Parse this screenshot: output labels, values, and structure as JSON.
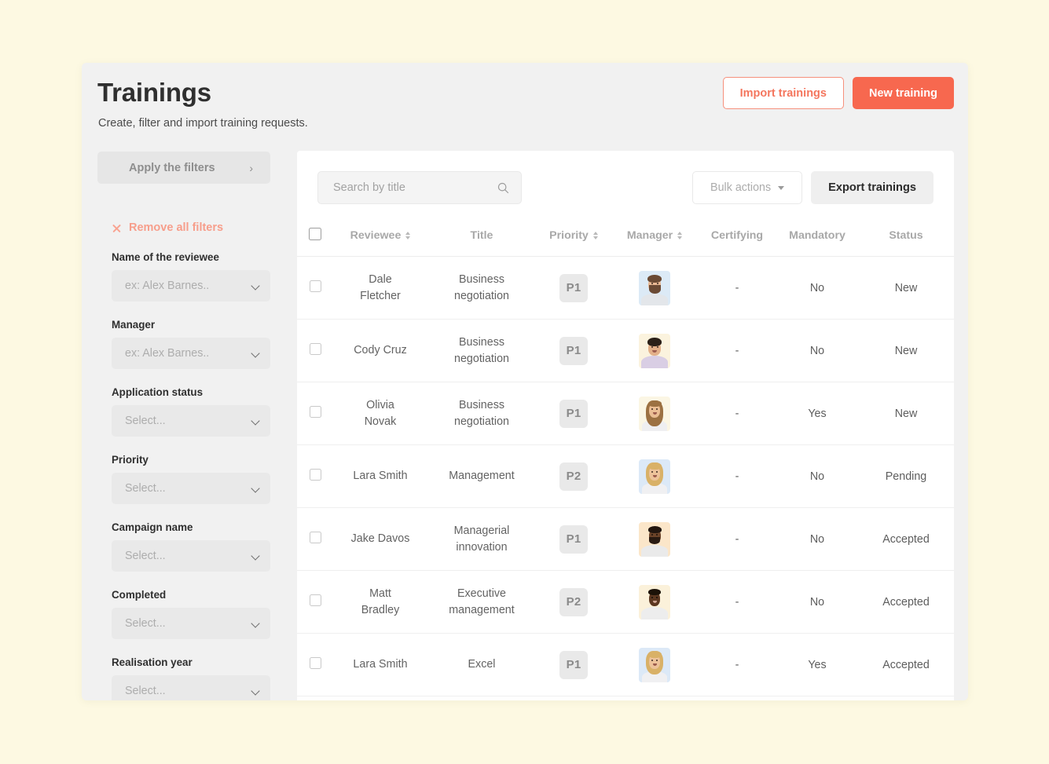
{
  "theme": {
    "page_background": "#FDF9E2",
    "card_background": "#F1F1F1",
    "panel_background": "#FFFFFF",
    "accent": "#F7684F",
    "accent_light": "#F79E8B"
  },
  "header": {
    "title": "Trainings",
    "subtitle": "Create, filter and import training requests.",
    "import_button": "Import trainings",
    "new_button": "New training"
  },
  "sidebar": {
    "apply_button": "Apply the filters",
    "apply_chevron_icon": "chevron-right-icon",
    "remove_all": "Remove all filters",
    "remove_all_icon": "close-x-icon",
    "filters": [
      {
        "label": "Name of the reviewee",
        "value": "ex: Alex Barnes.."
      },
      {
        "label": "Manager",
        "value": "ex: Alex Barnes.."
      },
      {
        "label": "Application status",
        "value": "Select..."
      },
      {
        "label": "Priority",
        "value": "Select..."
      },
      {
        "label": "Campaign name",
        "value": "Select..."
      },
      {
        "label": "Completed",
        "value": "Select..."
      },
      {
        "label": "Realisation year",
        "value": "Select..."
      }
    ]
  },
  "toolbar": {
    "search_placeholder": "Search by title",
    "search_value": "",
    "search_icon": "search-icon",
    "bulk_actions": "Bulk actions",
    "bulk_caret_icon": "caret-down-icon",
    "export_button": "Export trainings"
  },
  "table": {
    "columns": [
      {
        "key": "select",
        "label": "",
        "sortable": false
      },
      {
        "key": "reviewee",
        "label": "Reviewee",
        "sortable": true
      },
      {
        "key": "title",
        "label": "Title",
        "sortable": false
      },
      {
        "key": "priority",
        "label": "Priority",
        "sortable": true
      },
      {
        "key": "manager",
        "label": "Manager",
        "sortable": true
      },
      {
        "key": "certifying",
        "label": "Certifying",
        "sortable": false
      },
      {
        "key": "mandatory",
        "label": "Mandatory",
        "sortable": false
      },
      {
        "key": "status",
        "label": "Status",
        "sortable": false
      }
    ],
    "rows": [
      {
        "selected": false,
        "reviewee": "Dale Fletcher",
        "reviewee_line1": "Dale",
        "reviewee_line2": "Fletcher",
        "title": "Business negotiation",
        "title_line1": "Business",
        "title_line2": "negotiation",
        "priority": "P1",
        "manager_avatar": "avatar-bearded-man",
        "certifying": "-",
        "mandatory": "No",
        "status": "New"
      },
      {
        "selected": false,
        "reviewee": "Cody Cruz",
        "reviewee_line1": "Cody Cruz",
        "reviewee_line2": "",
        "title": "Business negotiation",
        "title_line1": "Business",
        "title_line2": "negotiation",
        "priority": "P1",
        "manager_avatar": "avatar-smiling-man",
        "certifying": "-",
        "mandatory": "No",
        "status": "New"
      },
      {
        "selected": false,
        "reviewee": "Olivia Novak",
        "reviewee_line1": "Olivia",
        "reviewee_line2": "Novak",
        "title": "Business negotiation",
        "title_line1": "Business",
        "title_line2": "negotiation",
        "priority": "P1",
        "manager_avatar": "avatar-long-hair-woman",
        "certifying": "-",
        "mandatory": "Yes",
        "status": "New"
      },
      {
        "selected": false,
        "reviewee": "Lara Smith",
        "reviewee_line1": "Lara Smith",
        "reviewee_line2": "",
        "title": "Management",
        "title_line1": "Management",
        "title_line2": "",
        "priority": "P2",
        "manager_avatar": "avatar-blonde-woman",
        "certifying": "-",
        "mandatory": "No",
        "status": "Pending"
      },
      {
        "selected": false,
        "reviewee": "Jake Davos",
        "reviewee_line1": "Jake Davos",
        "reviewee_line2": "",
        "title": "Managerial innovation",
        "title_line1": "Managerial",
        "title_line2": "innovation",
        "priority": "P1",
        "manager_avatar": "avatar-bearded-man-dark",
        "certifying": "-",
        "mandatory": "No",
        "status": "Accepted"
      },
      {
        "selected": false,
        "reviewee": "Matt Bradley",
        "reviewee_line1": "Matt",
        "reviewee_line2": "Bradley",
        "title": "Executive management",
        "title_line1": "Executive",
        "title_line2": "management",
        "priority": "P2",
        "manager_avatar": "avatar-short-hair-person",
        "certifying": "-",
        "mandatory": "No",
        "status": "Accepted"
      },
      {
        "selected": false,
        "reviewee": "Lara Smith",
        "reviewee_line1": "Lara Smith",
        "reviewee_line2": "",
        "title": "Excel",
        "title_line1": "Excel",
        "title_line2": "",
        "priority": "P1",
        "manager_avatar": "avatar-blonde-woman",
        "certifying": "-",
        "mandatory": "Yes",
        "status": "Accepted"
      }
    ]
  }
}
